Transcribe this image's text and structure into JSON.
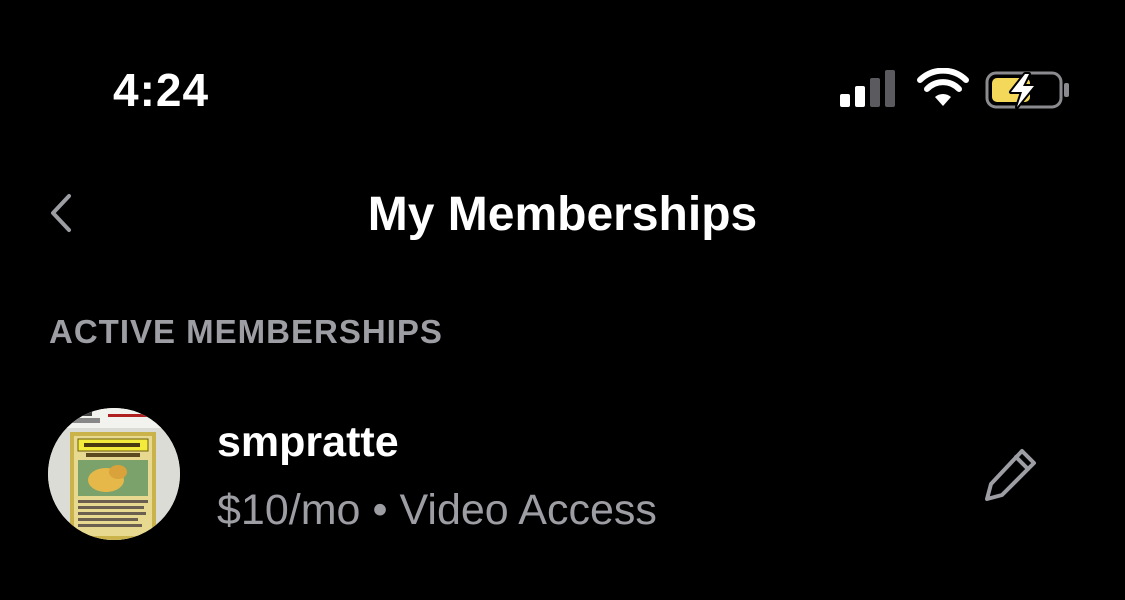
{
  "status_bar": {
    "time": "4:24",
    "signal_icon": "cellular-signal-icon",
    "wifi_icon": "wifi-icon",
    "battery_icon": "battery-charging-icon",
    "battery_color": "#f4d85a"
  },
  "nav": {
    "back_icon": "chevron-left-icon",
    "title": "My Memberships"
  },
  "section": {
    "header": "ACTIVE MEMBERSHIPS"
  },
  "memberships": [
    {
      "name": "smpratte",
      "price": "$10/mo",
      "separator": "•",
      "tier": "Video Access",
      "edit_icon": "pencil-icon",
      "avatar_card": {
        "grader": "PSA",
        "label_text": "ILLUSTRATOR",
        "subtitle": "ポケモンイラストレーター"
      }
    }
  ],
  "colors": {
    "background": "#000000",
    "primary_text": "#ffffff",
    "secondary_text": "#9d9da4"
  }
}
